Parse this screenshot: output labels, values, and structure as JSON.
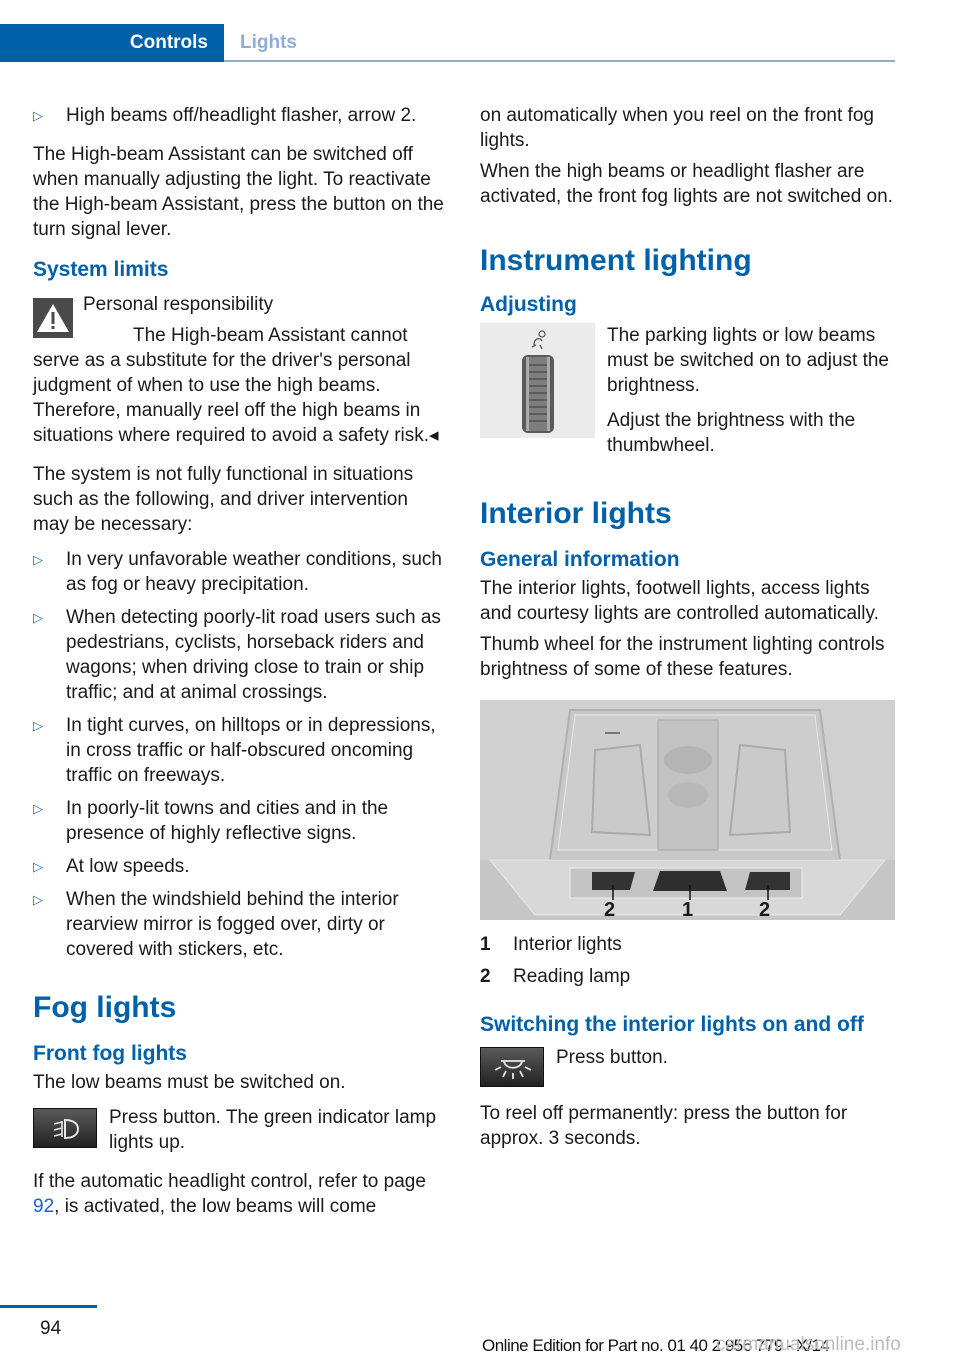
{
  "header": {
    "section": "Controls",
    "subsection": "Lights"
  },
  "left": {
    "bullet_top": "High beams off/headlight flasher, arrow 2.",
    "para1": "The High-beam Assistant can be switched off when manually adjusting the light. To reactivate the High-beam Assistant, press the button on the turn signal lever.",
    "system_limits": {
      "heading": "System limits",
      "warning_title": "Personal responsibility",
      "warning_text": "The High-beam Assistant cannot serve as a substitute for the driver's personal judgment of when to use the high beams. Therefore, manually reel off the high beams in situations where required to avoid a safety risk.◂",
      "intro": "The system is not fully functional in situations such as the following, and driver intervention may be necessary:",
      "items": [
        "In very unfavorable weather conditions, such as fog or heavy precipitation.",
        "When detecting poorly-lit road users such as pedestrians, cyclists, horseback riders and wagons; when driving close to train or ship traffic; and at animal crossings.",
        "In tight curves, on hilltops or in depressions, in cross traffic or half-obscured oncoming traffic on freeways.",
        "In poorly-lit towns and cities and in the presence of highly reflective signs.",
        "At low speeds.",
        "When the windshield behind the interior rearview mirror is fogged over, dirty or covered with stickers, etc."
      ]
    },
    "fog": {
      "heading": "Fog lights",
      "subheading": "Front fog lights",
      "text1": "The low beams must be switched on.",
      "button_text": "Press button. The green indicator lamp lights up.",
      "text2_a": "If the automatic headlight control, refer to page ",
      "text2_link": "92",
      "text2_b": ", is activated, the low beams will come"
    }
  },
  "right": {
    "cont1": "on automatically when you reel on the front fog lights.",
    "cont2": "When the high beams or headlight flasher are activated, the front fog lights are not switched on.",
    "instrument": {
      "heading": "Instrument lighting",
      "subheading": "Adjusting",
      "text1": "The parking lights or low beams must be switched on to adjust the brightness.",
      "text2": "Adjust the brightness with the thumbwheel."
    },
    "interior": {
      "heading": "Interior lights",
      "subheading": "General information",
      "text1": "The interior lights, footwell lights, access lights and courtesy lights are controlled automatically.",
      "text2": "Thumb wheel for the instrument lighting controls brightness of some of these features.",
      "photo_labels": [
        "2",
        "1",
        "2"
      ],
      "legend": [
        {
          "num": "1",
          "label": "Interior lights"
        },
        {
          "num": "2",
          "label": "Reading lamp"
        }
      ],
      "switch_heading": "Switching the interior lights on and off",
      "button_text": "Press button.",
      "text3": "To reel off permanently: press the button for approx. 3 seconds."
    }
  },
  "footer": {
    "page": "94",
    "edition": "Online Edition for Part no. 01 40 2 956 779 - X/14",
    "watermark": "carmanualsonline.info"
  },
  "colors": {
    "brand_blue": "#0060a8",
    "tab_inactive": "#8eaed8",
    "link": "#1a5fd8"
  }
}
